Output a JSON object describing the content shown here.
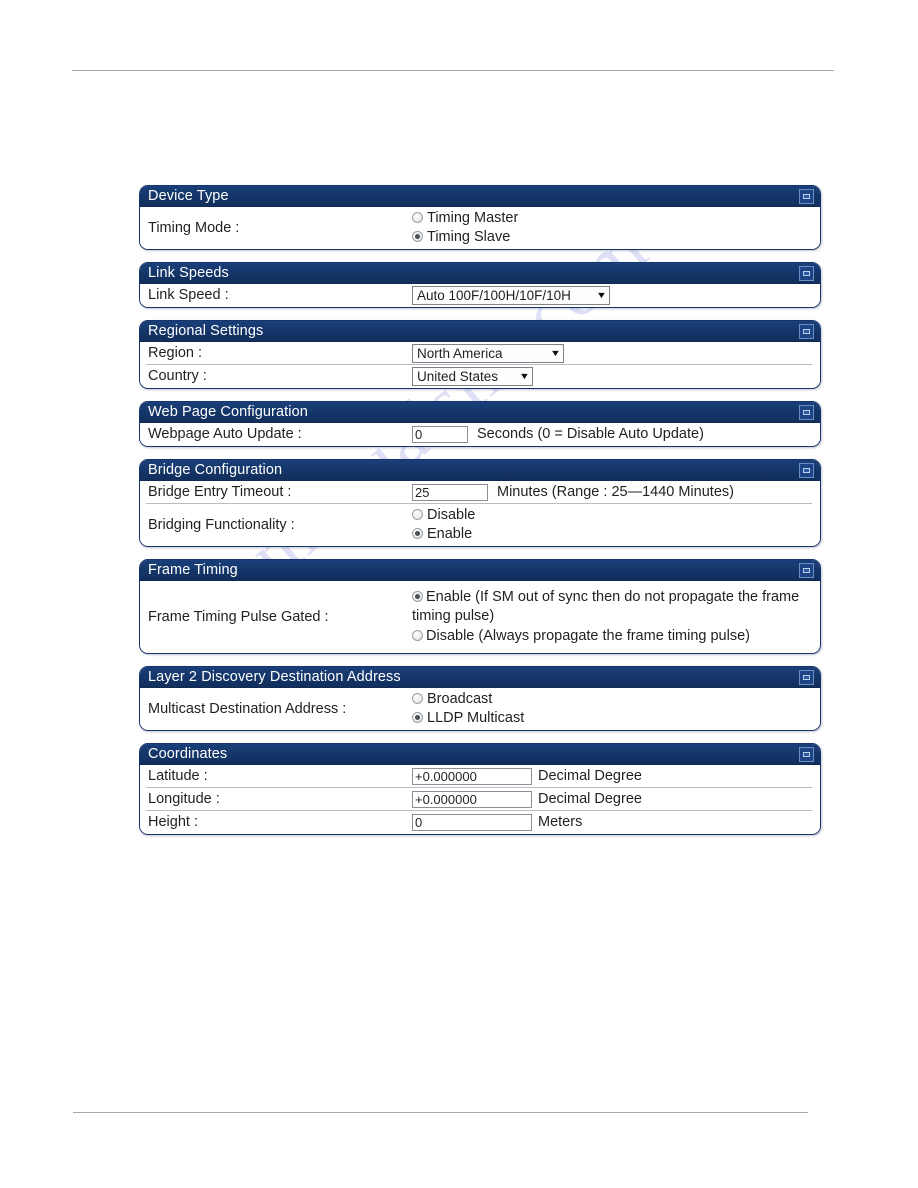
{
  "watermark": {
    "text": "manualslib.com"
  },
  "icons": {
    "collapse": "collapse-minus-icon",
    "caret": "▼"
  },
  "panels": [
    {
      "title": "Device Type",
      "rows": [
        {
          "label": "Timing Mode :",
          "options": [
            {
              "label": "Timing Master",
              "selected": false
            },
            {
              "label": "Timing Slave",
              "selected": true
            }
          ]
        }
      ]
    },
    {
      "title": "Link Speeds",
      "rows": [
        {
          "label": "Link Speed :",
          "select_value": "Auto 100F/100H/10F/10H"
        }
      ]
    },
    {
      "title": "Regional Settings",
      "rows": [
        {
          "label": "Region :",
          "select_value": "North America"
        },
        {
          "label": "Country :",
          "select_value": "United States"
        }
      ]
    },
    {
      "title": "Web Page Configuration",
      "rows": [
        {
          "label": "Webpage Auto Update :",
          "input_value": "0",
          "unit": "Seconds (0 = Disable Auto Update)"
        }
      ]
    },
    {
      "title": "Bridge Configuration",
      "rows": [
        {
          "label": "Bridge Entry Timeout :",
          "input_value": "25",
          "unit": "Minutes (Range : 25—1440 Minutes)"
        },
        {
          "label": "Bridging Functionality :",
          "options": [
            {
              "label": "Disable",
              "selected": false
            },
            {
              "label": "Enable",
              "selected": true
            }
          ]
        }
      ]
    },
    {
      "title": "Frame Timing",
      "rows": [
        {
          "label": "Frame Timing Pulse Gated :",
          "options": [
            {
              "label": "Enable (If SM out of sync then do not propagate the frame timing pulse)",
              "selected": true
            },
            {
              "label": "Disable (Always propagate the frame timing pulse)",
              "selected": false
            }
          ]
        }
      ]
    },
    {
      "title": "Layer 2 Discovery Destination Address",
      "rows": [
        {
          "label": "Multicast Destination Address :",
          "options": [
            {
              "label": "Broadcast",
              "selected": false
            },
            {
              "label": "LLDP Multicast",
              "selected": true
            }
          ]
        }
      ]
    },
    {
      "title": "Coordinates",
      "rows": [
        {
          "label": "Latitude :",
          "input_value": "+0.000000",
          "unit": "Decimal Degree"
        },
        {
          "label": "Longitude :",
          "input_value": "+0.000000",
          "unit": "Decimal Degree"
        },
        {
          "label": "Height :",
          "input_value": "0",
          "unit": "Meters"
        }
      ]
    }
  ]
}
